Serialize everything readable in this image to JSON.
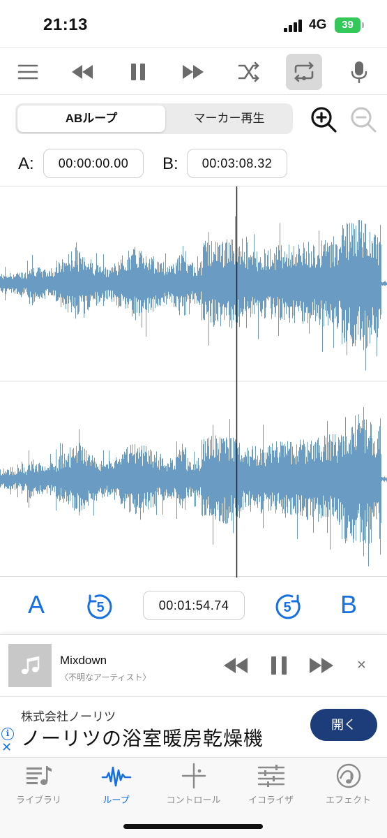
{
  "status_bar": {
    "time": "21:13",
    "network": "4G",
    "battery": "39"
  },
  "toolbar": {
    "icons": [
      "menu-icon",
      "rewind-icon",
      "pause-icon",
      "fast-forward-icon",
      "shuffle-icon",
      "repeat-icon",
      "microphone-icon"
    ],
    "active": "repeat-icon"
  },
  "mode": {
    "ab_loop_label": "ABループ",
    "marker_label": "マーカー再生",
    "selected": "ABループ"
  },
  "ab": {
    "a_label": "A:",
    "a_time": "00:00:00.00",
    "b_label": "B:",
    "b_time": "00:03:08.32"
  },
  "waveform": {
    "channels": 2,
    "color": "#6a9bc3",
    "playhead_position": 0.61
  },
  "playback": {
    "a_button": "A",
    "b_button": "B",
    "skip_back_seconds": "5",
    "skip_forward_seconds": "5",
    "current_time": "00:01:54.74"
  },
  "now_playing": {
    "title": "Mixdown",
    "artist": "〈不明なアーティスト〉",
    "close": "×"
  },
  "ad": {
    "company": "株式会社ノーリツ",
    "headline": "ノーリツの浴室暖房乾燥機",
    "cta": "開く",
    "info": "i",
    "close": "✕"
  },
  "tabs": [
    {
      "label": "ライブラリ",
      "icon": "library-icon"
    },
    {
      "label": "ループ",
      "icon": "waveform-icon"
    },
    {
      "label": "コントロール",
      "icon": "crosshair-icon"
    },
    {
      "label": "イコライザ",
      "icon": "equalizer-icon"
    },
    {
      "label": "エフェクト",
      "icon": "effects-icon"
    }
  ],
  "active_tab": "ループ",
  "colors": {
    "accent": "#1670e0",
    "battery": "#34c759",
    "ad_button": "#1c3d7a",
    "waveform": "#6a9bc3"
  }
}
